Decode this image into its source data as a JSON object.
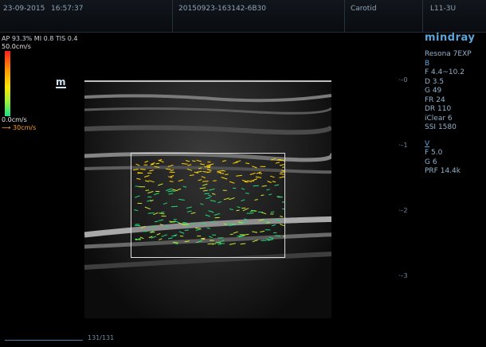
{
  "header": {
    "date": "23-09-2015",
    "time": "16:57:37",
    "study_id": "20150923-163142-6B30",
    "preset": "Carotid",
    "probe": "L11-3U"
  },
  "left_panel": {
    "acoustic_params": "AP 93.3%  MI 0.8 TIS 0.4",
    "velocity_max": "50.0cm/s",
    "velocity_min": "0.0cm/s",
    "arrow_speed": "30cm/s",
    "marker": "m"
  },
  "right_panel": {
    "brand": "mindray",
    "model": "Resona 7EXP",
    "b_mode": {
      "heading": "B",
      "lines": [
        "F 4.4~10.2",
        "D 3.5",
        "G 49",
        "FR 24",
        "DR 110",
        "iClear 6",
        "SSI 1580"
      ]
    },
    "v_mode": {
      "heading": "V",
      "lines": [
        "F 5.0",
        "G 6",
        "PRF 14.4k"
      ]
    }
  },
  "depth_ticks": [
    "0",
    "1",
    "2",
    "3"
  ],
  "footer": {
    "frame_counter": "131/131"
  },
  "colors": {
    "accent": "#5aa6dc",
    "roi_border": "#e0e0e0",
    "flow_fast": "#ffd400",
    "flow_slow": "#21d97a"
  }
}
